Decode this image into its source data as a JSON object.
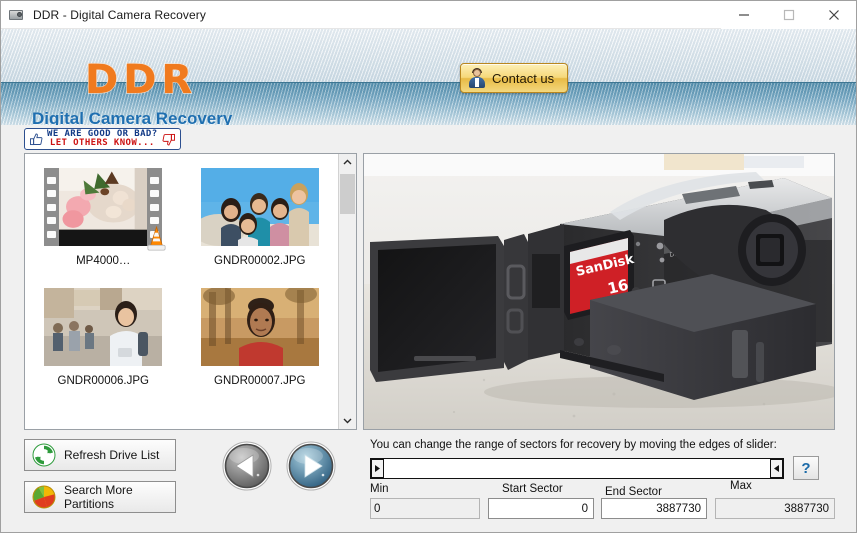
{
  "window": {
    "title": "DDR - Digital Camera Recovery",
    "icon": "camera-icon",
    "minimize_label": "—",
    "maximize_label": "□",
    "close_label": "✕"
  },
  "banner": {
    "logo": "DDR",
    "subtitle": "Digital Camera Recovery",
    "contact_label": "Contact us",
    "contact_icon": "user-avatar-icon",
    "logo_color": "#f07a1e",
    "subtitle_color": "#1f6fb0"
  },
  "feedback": {
    "line1": "WE ARE GOOD OR BAD?",
    "line2": "LET OTHERS KNOW...",
    "thumbs_up_icon": "thumbs-up-icon",
    "thumbs_down_icon": "thumbs-down-icon",
    "line1_color": "#123a86",
    "line2_color": "#cc1111"
  },
  "thumbnails": {
    "items": [
      {
        "caption": "MP4000…",
        "type": "video",
        "overlay_icon": "vlc-cone-icon"
      },
      {
        "caption": "GNDR00002.JPG",
        "type": "image",
        "overlay_icon": ""
      },
      {
        "caption": "GNDR00006.JPG",
        "type": "image",
        "overlay_icon": ""
      },
      {
        "caption": "GNDR00007.JPG",
        "type": "image",
        "overlay_icon": ""
      }
    ],
    "scrollbar": {
      "up_icon": "chevron-up-icon",
      "down_icon": "chevron-down-icon"
    }
  },
  "preview": {
    "alt": "camcorder-with-sandisk-sd-card-photo",
    "sd_card_brand": "SanDisk",
    "sd_card_capacity": "16"
  },
  "actions": {
    "refresh_label": "Refresh Drive List",
    "refresh_icon": "refresh-icon",
    "search_label": "Search More Partitions",
    "search_icon": "partition-pie-icon",
    "back_icon": "previous-arrow-icon",
    "next_icon": "next-arrow-icon"
  },
  "sector": {
    "hint": "You can change the range of sectors for recovery by moving the edges of slider:",
    "left_handle_icon": "slider-left-handle-icon",
    "right_handle_icon": "slider-right-handle-icon",
    "help_label": "?",
    "min_label": "Min",
    "min_value": "0",
    "start_label": "Start Sector",
    "start_value": "0",
    "end_label": "End Sector",
    "end_value": "3887730",
    "max_label": "Max",
    "max_value": "3887730"
  }
}
